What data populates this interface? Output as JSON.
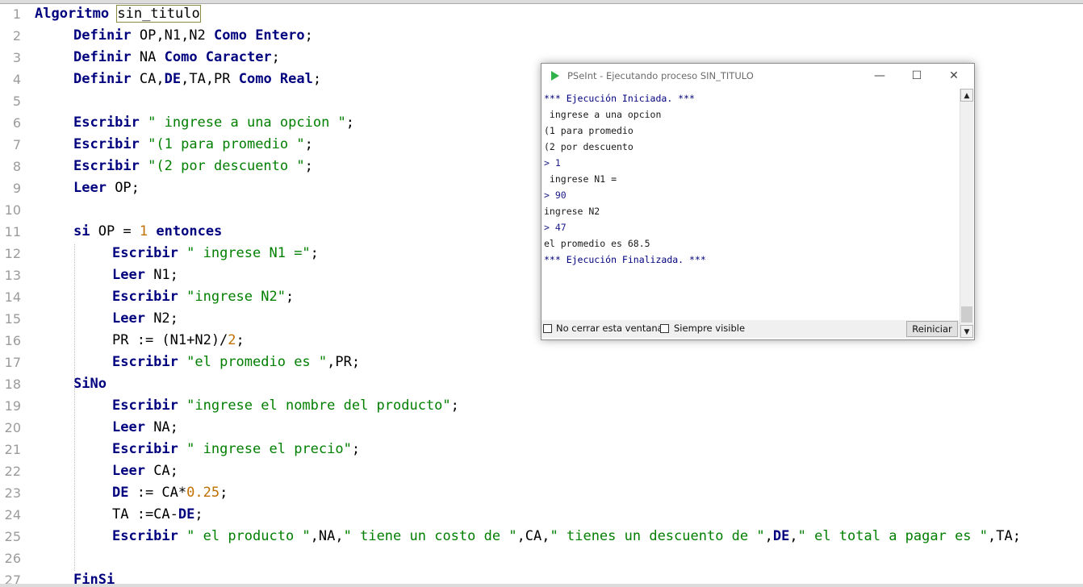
{
  "editor": {
    "lines": [
      {
        "n": "1",
        "indent": 0,
        "tokens": [
          {
            "t": "Algoritmo",
            "c": "kw"
          },
          {
            "t": " ",
            "c": "ident"
          },
          {
            "t": "sin_titulo",
            "c": "ident boxed"
          }
        ]
      },
      {
        "n": "2",
        "indent": 1,
        "tokens": [
          {
            "t": "Definir",
            "c": "kw"
          },
          {
            "t": " OP,N1,N2 ",
            "c": "ident"
          },
          {
            "t": "Como Entero",
            "c": "kw"
          },
          {
            "t": ";",
            "c": "op"
          }
        ]
      },
      {
        "n": "3",
        "indent": 1,
        "tokens": [
          {
            "t": "Definir",
            "c": "kw"
          },
          {
            "t": " NA ",
            "c": "ident"
          },
          {
            "t": "Como Caracter",
            "c": "kw"
          },
          {
            "t": ";",
            "c": "op"
          }
        ]
      },
      {
        "n": "4",
        "indent": 1,
        "tokens": [
          {
            "t": "Definir",
            "c": "kw"
          },
          {
            "t": " CA,",
            "c": "ident"
          },
          {
            "t": "DE",
            "c": "kw"
          },
          {
            "t": ",TA,PR ",
            "c": "ident"
          },
          {
            "t": "Como Real",
            "c": "kw"
          },
          {
            "t": ";",
            "c": "op"
          }
        ]
      },
      {
        "n": "5",
        "indent": 0,
        "tokens": []
      },
      {
        "n": "6",
        "indent": 1,
        "tokens": [
          {
            "t": "Escribir",
            "c": "kw"
          },
          {
            "t": " ",
            "c": "ident"
          },
          {
            "t": "\" ingrese a una opcion \"",
            "c": "str"
          },
          {
            "t": ";",
            "c": "op"
          }
        ]
      },
      {
        "n": "7",
        "indent": 1,
        "tokens": [
          {
            "t": "Escribir",
            "c": "kw"
          },
          {
            "t": " ",
            "c": "ident"
          },
          {
            "t": "\"(1 para promedio \"",
            "c": "str"
          },
          {
            "t": ";",
            "c": "op"
          }
        ]
      },
      {
        "n": "8",
        "indent": 1,
        "tokens": [
          {
            "t": "Escribir",
            "c": "kw"
          },
          {
            "t": " ",
            "c": "ident"
          },
          {
            "t": "\"(2 por descuento \"",
            "c": "str"
          },
          {
            "t": ";",
            "c": "op"
          }
        ]
      },
      {
        "n": "9",
        "indent": 1,
        "tokens": [
          {
            "t": "Leer",
            "c": "kw"
          },
          {
            "t": " OP;",
            "c": "ident"
          }
        ]
      },
      {
        "n": "10",
        "indent": 0,
        "tokens": []
      },
      {
        "n": "11",
        "indent": 1,
        "tokens": [
          {
            "t": "si",
            "c": "kw"
          },
          {
            "t": " OP = ",
            "c": "ident"
          },
          {
            "t": "1",
            "c": "num"
          },
          {
            "t": " ",
            "c": "ident"
          },
          {
            "t": "entonces",
            "c": "kw"
          }
        ]
      },
      {
        "n": "12",
        "indent": 2,
        "tokens": [
          {
            "t": "Escribir",
            "c": "kw"
          },
          {
            "t": " ",
            "c": "ident"
          },
          {
            "t": "\" ingrese N1 =\"",
            "c": "str"
          },
          {
            "t": ";",
            "c": "op"
          }
        ]
      },
      {
        "n": "13",
        "indent": 2,
        "tokens": [
          {
            "t": "Leer",
            "c": "kw"
          },
          {
            "t": " N1;",
            "c": "ident"
          }
        ]
      },
      {
        "n": "14",
        "indent": 2,
        "tokens": [
          {
            "t": "Escribir",
            "c": "kw"
          },
          {
            "t": " ",
            "c": "ident"
          },
          {
            "t": "\"ingrese N2\"",
            "c": "str"
          },
          {
            "t": ";",
            "c": "op"
          }
        ]
      },
      {
        "n": "15",
        "indent": 2,
        "tokens": [
          {
            "t": "Leer",
            "c": "kw"
          },
          {
            "t": " N2;",
            "c": "ident"
          }
        ]
      },
      {
        "n": "16",
        "indent": 2,
        "tokens": [
          {
            "t": "PR := (N1+N2)/",
            "c": "ident"
          },
          {
            "t": "2",
            "c": "num"
          },
          {
            "t": ";",
            "c": "op"
          }
        ]
      },
      {
        "n": "17",
        "indent": 2,
        "tokens": [
          {
            "t": "Escribir",
            "c": "kw"
          },
          {
            "t": " ",
            "c": "ident"
          },
          {
            "t": "\"el promedio es \"",
            "c": "str"
          },
          {
            "t": ",PR;",
            "c": "ident"
          }
        ]
      },
      {
        "n": "18",
        "indent": 1,
        "tokens": [
          {
            "t": "SiNo",
            "c": "kw"
          }
        ]
      },
      {
        "n": "19",
        "indent": 2,
        "tokens": [
          {
            "t": "Escribir",
            "c": "kw"
          },
          {
            "t": " ",
            "c": "ident"
          },
          {
            "t": "\"ingrese el nombre del producto\"",
            "c": "str"
          },
          {
            "t": ";",
            "c": "op"
          }
        ]
      },
      {
        "n": "20",
        "indent": 2,
        "tokens": [
          {
            "t": "Leer",
            "c": "kw"
          },
          {
            "t": " NA;",
            "c": "ident"
          }
        ]
      },
      {
        "n": "21",
        "indent": 2,
        "tokens": [
          {
            "t": "Escribir",
            "c": "kw"
          },
          {
            "t": " ",
            "c": "ident"
          },
          {
            "t": "\" ingrese el precio\"",
            "c": "str"
          },
          {
            "t": ";",
            "c": "op"
          }
        ]
      },
      {
        "n": "22",
        "indent": 2,
        "tokens": [
          {
            "t": "Leer",
            "c": "kw"
          },
          {
            "t": " CA;",
            "c": "ident"
          }
        ]
      },
      {
        "n": "23",
        "indent": 2,
        "tokens": [
          {
            "t": "DE",
            "c": "kw"
          },
          {
            "t": " := CA*",
            "c": "ident"
          },
          {
            "t": "0.25",
            "c": "num"
          },
          {
            "t": ";",
            "c": "op"
          }
        ]
      },
      {
        "n": "24",
        "indent": 2,
        "tokens": [
          {
            "t": "TA :=CA-",
            "c": "ident"
          },
          {
            "t": "DE",
            "c": "kw"
          },
          {
            "t": ";",
            "c": "op"
          }
        ]
      },
      {
        "n": "25",
        "indent": 2,
        "tokens": [
          {
            "t": "Escribir",
            "c": "kw"
          },
          {
            "t": " ",
            "c": "ident"
          },
          {
            "t": "\" el producto \"",
            "c": "str"
          },
          {
            "t": ",NA,",
            "c": "ident"
          },
          {
            "t": "\" tiene un costo de \"",
            "c": "str"
          },
          {
            "t": ",CA,",
            "c": "ident"
          },
          {
            "t": "\" tienes un descuento de \"",
            "c": "str"
          },
          {
            "t": ",",
            "c": "ident"
          },
          {
            "t": "DE",
            "c": "kw"
          },
          {
            "t": ",",
            "c": "ident"
          },
          {
            "t": "\" el total a pagar es \"",
            "c": "str"
          },
          {
            "t": ",TA;",
            "c": "ident"
          }
        ]
      },
      {
        "n": "26",
        "indent": 0,
        "tokens": []
      },
      {
        "n": "27",
        "indent": 1,
        "tokens": [
          {
            "t": "FinSi",
            "c": "kw"
          }
        ]
      }
    ]
  },
  "run_window": {
    "title": "PSeInt - Ejecutando proceso SIN_TITULO",
    "minimize": "—",
    "maximize": "☐",
    "close": "✕",
    "console_lines": [
      {
        "text": "*** Ejecución Iniciada. ***",
        "kind": "sys"
      },
      {
        "text": " ingrese a una opcion",
        "kind": "out"
      },
      {
        "text": "(1 para promedio",
        "kind": "out"
      },
      {
        "text": "(2 por descuento",
        "kind": "out"
      },
      {
        "text": "> 1",
        "kind": "in"
      },
      {
        "text": " ingrese N1 =",
        "kind": "out"
      },
      {
        "text": "> 90",
        "kind": "in"
      },
      {
        "text": "ingrese N2",
        "kind": "out"
      },
      {
        "text": "> 47",
        "kind": "in"
      },
      {
        "text": "el promedio es 68.5",
        "kind": "out"
      },
      {
        "text": "*** Ejecución Finalizada. ***",
        "kind": "sys"
      }
    ],
    "no_close_label": "No cerrar esta ventana",
    "always_visible_label": "Siempre visible",
    "restart_label": "Reiniciar",
    "scroll_up": "▲",
    "scroll_down": "▼"
  },
  "colors": {
    "keyword": "#00007f",
    "string": "#007f00",
    "number": "#c07000",
    "app_icon": "#2fb24a"
  }
}
